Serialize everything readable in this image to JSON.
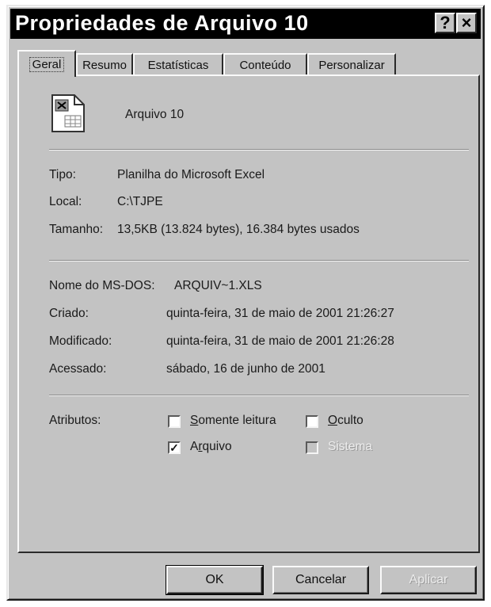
{
  "window": {
    "title": "Propriedades de Arquivo 10",
    "help_label": "?",
    "close_label": "×"
  },
  "tabs": [
    {
      "label": "Geral",
      "active": true
    },
    {
      "label": "Resumo",
      "active": false
    },
    {
      "label": "Estatísticas",
      "active": false
    },
    {
      "label": "Conteúdo",
      "active": false
    },
    {
      "label": "Personalizar",
      "active": false
    }
  ],
  "file": {
    "name": "Arquivo 10",
    "icon": "excel-file-icon"
  },
  "info": {
    "tipo_label": "Tipo:",
    "tipo_value": "Planilha do Microsoft Excel",
    "local_label": "Local:",
    "local_value": "C:\\TJPE",
    "tamanho_label": "Tamanho:",
    "tamanho_value": "13,5KB (13.824 bytes), 16.384 bytes usados"
  },
  "details": {
    "msdos_label": "Nome do MS-DOS:",
    "msdos_value": "ARQUIV~1.XLS",
    "criado_label": "Criado:",
    "criado_value": "quinta-feira, 31 de maio de 2001 21:26:27",
    "modificado_label": "Modificado:",
    "modificado_value": "quinta-feira, 31 de maio de 2001 21:26:28",
    "acessado_label": "Acessado:",
    "acessado_value": "sábado, 16 de junho de 2001"
  },
  "attributes": {
    "label": "Atributos:",
    "somente_leitura": {
      "label": "Somente leitura",
      "checked": false
    },
    "oculto": {
      "label": "Oculto",
      "checked": false
    },
    "arquivo": {
      "label": "Arquivo",
      "checked": true
    },
    "sistema": {
      "label": "Sistema",
      "checked": false,
      "disabled": true
    }
  },
  "buttons": {
    "ok": "OK",
    "cancelar": "Cancelar",
    "aplicar": "Aplicar"
  },
  "check_mark": "✓"
}
